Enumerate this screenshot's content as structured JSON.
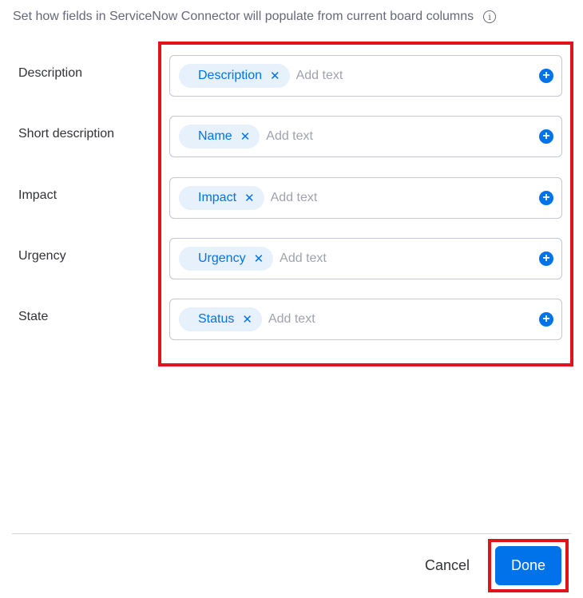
{
  "header": {
    "text": "Set how fields in ServiceNow Connector will populate from current board columns",
    "info_icon": "info-icon"
  },
  "fields": [
    {
      "label": "Description",
      "chip": "Description",
      "placeholder": "Add text"
    },
    {
      "label": "Short description",
      "chip": "Name",
      "placeholder": "Add text"
    },
    {
      "label": "Impact",
      "chip": "Impact",
      "placeholder": "Add text"
    },
    {
      "label": "Urgency",
      "chip": "Urgency",
      "placeholder": "Add text"
    },
    {
      "label": "State",
      "chip": "Status",
      "placeholder": "Add text"
    }
  ],
  "chip_remove_glyph": "✕",
  "add_glyph": "+",
  "footer": {
    "cancel_label": "Cancel",
    "done_label": "Done"
  },
  "colors": {
    "accent": "#0073ea",
    "chip_bg": "#e6f1fc",
    "highlight": "#e0131d"
  }
}
